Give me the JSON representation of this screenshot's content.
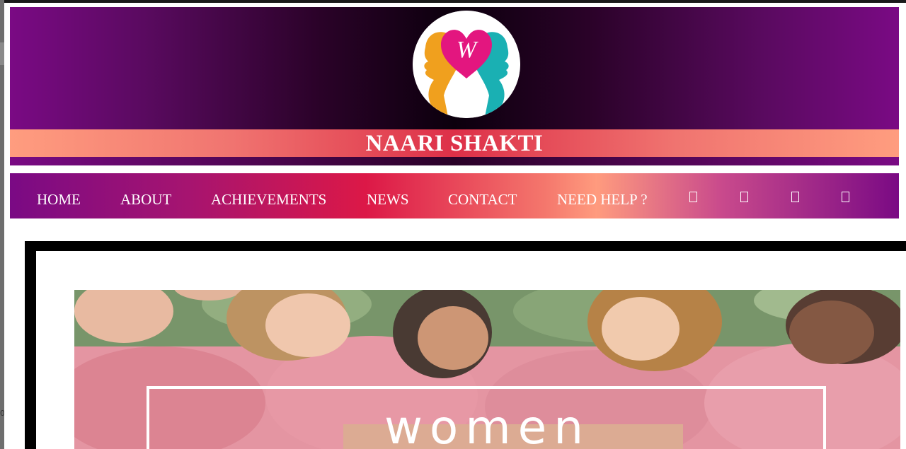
{
  "site": {
    "title": "NAARI SHAKTI",
    "logo_letter": "W"
  },
  "nav": {
    "items": [
      {
        "label": "HOME"
      },
      {
        "label": "ABOUT"
      },
      {
        "label": "ACHIEVEMENTS"
      },
      {
        "label": "NEWS"
      },
      {
        "label": "CONTACT"
      },
      {
        "label": "NEED HELP ?"
      }
    ],
    "icons": [
      "icon-1",
      "icon-2",
      "icon-3",
      "icon-4"
    ]
  },
  "hero": {
    "word": "women"
  },
  "side_marker": "0",
  "colors": {
    "purple": "#7a0a84",
    "dark": "#0c000d",
    "coral": "#f07470",
    "crimson": "#dc1847",
    "logo_magenta": "#e3167f",
    "logo_orange": "#f0a01e",
    "logo_teal": "#1ab0b3"
  }
}
